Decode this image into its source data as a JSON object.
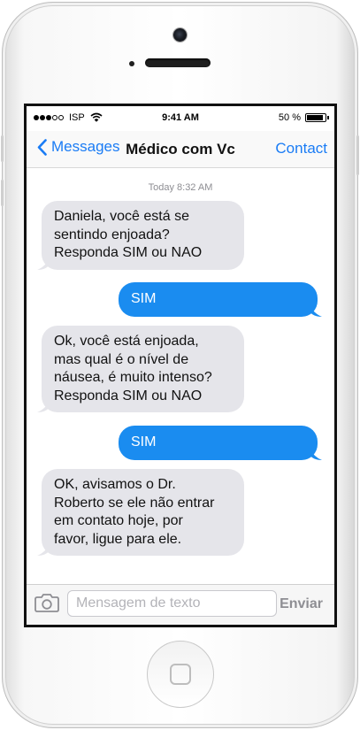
{
  "status_bar": {
    "carrier": "ISP",
    "time": "9:41 AM",
    "battery": "50 %",
    "battery_level": 0.9,
    "signal_bars": 3,
    "signal_max": 5
  },
  "nav": {
    "back_label": "Messages",
    "title": "Médico com Vc",
    "contact_label": "Contact"
  },
  "conversation": {
    "timestamp": "Today 8:32 AM",
    "messages": [
      {
        "from": "received",
        "lines": [
          "Daniela, você está se",
          "sentindo enjoada?",
          "Responda SIM ou NAO"
        ]
      },
      {
        "from": "sent",
        "lines": [
          "SIM"
        ]
      },
      {
        "from": "received",
        "lines": [
          "Ok, você está enjoada,",
          "mas qual é o nível de",
          "náusea, é muito intenso?",
          "Responda SIM ou NAO"
        ]
      },
      {
        "from": "sent",
        "lines": [
          "SIM"
        ]
      },
      {
        "from": "received",
        "lines": [
          "OK, avisamos o Dr.",
          "Roberto se ele não entrar",
          "em contato hoje, por",
          "favor, ligue para ele."
        ]
      }
    ]
  },
  "composer": {
    "placeholder": "Mensagem de texto",
    "value": "",
    "send_label": "Enviar"
  },
  "colors": {
    "accent": "#1a7cf5",
    "sent_bubble": "#1a8cf0",
    "received_bubble": "#e5e5ea"
  },
  "icons": {
    "back": "chevron-left-icon",
    "wifi": "wifi-icon",
    "camera": "camera-icon",
    "home": "home-button-icon"
  }
}
